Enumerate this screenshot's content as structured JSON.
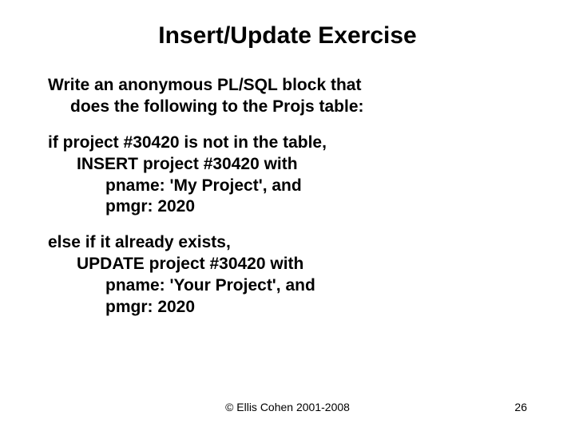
{
  "title": "Insert/Update Exercise",
  "intro": {
    "line1": "Write an anonymous PL/SQL block that",
    "line2": "does the following to the Projs table:"
  },
  "block_if": {
    "l1": "if project #30420 is not in the table,",
    "l2": "INSERT project #30420 with",
    "l3a": "pname: 'My Project', and",
    "l3b": "pmgr: 2020"
  },
  "block_else": {
    "l1": "else if it already exists,",
    "l2": "UPDATE project #30420 with",
    "l3a": "pname: 'Your Project', and",
    "l3b": "pmgr: 2020"
  },
  "footer": "© Ellis Cohen 2001-2008",
  "pagenum": "26"
}
